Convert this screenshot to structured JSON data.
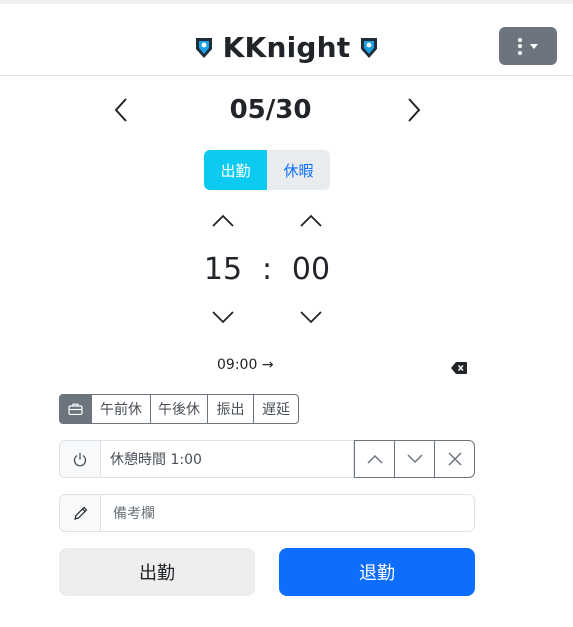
{
  "header": {
    "title": "KKnight",
    "logo_icon": "knight-shield-icon",
    "menu_icon": "kebab-dropdown-icon",
    "menu_color": "#6c757d"
  },
  "date": {
    "value": "05/30",
    "prev_icon": "chevron-left-icon",
    "next_icon": "chevron-right-icon"
  },
  "mode": {
    "options": [
      "出勤",
      "休暇"
    ],
    "selected": "出勤",
    "accent": "#0dcaf0"
  },
  "time": {
    "hour": "15",
    "separator": ":",
    "minute": "00"
  },
  "range": {
    "start": "09:00",
    "arrow": "→",
    "clear_icon": "backspace-icon"
  },
  "options": {
    "icon": "briefcase-icon",
    "items": [
      "午前休",
      "午後休",
      "振出",
      "遅延"
    ]
  },
  "break": {
    "icon": "power-icon",
    "text": "休憩時間 1:00",
    "buttons": [
      "chevron-up-icon",
      "chevron-down-icon",
      "close-icon"
    ]
  },
  "memo": {
    "icon": "pencil-icon",
    "placeholder": "備考欄"
  },
  "actions": {
    "clock_in": "出勤",
    "clock_out": "退勤",
    "clock_out_color": "#0d6efd"
  }
}
